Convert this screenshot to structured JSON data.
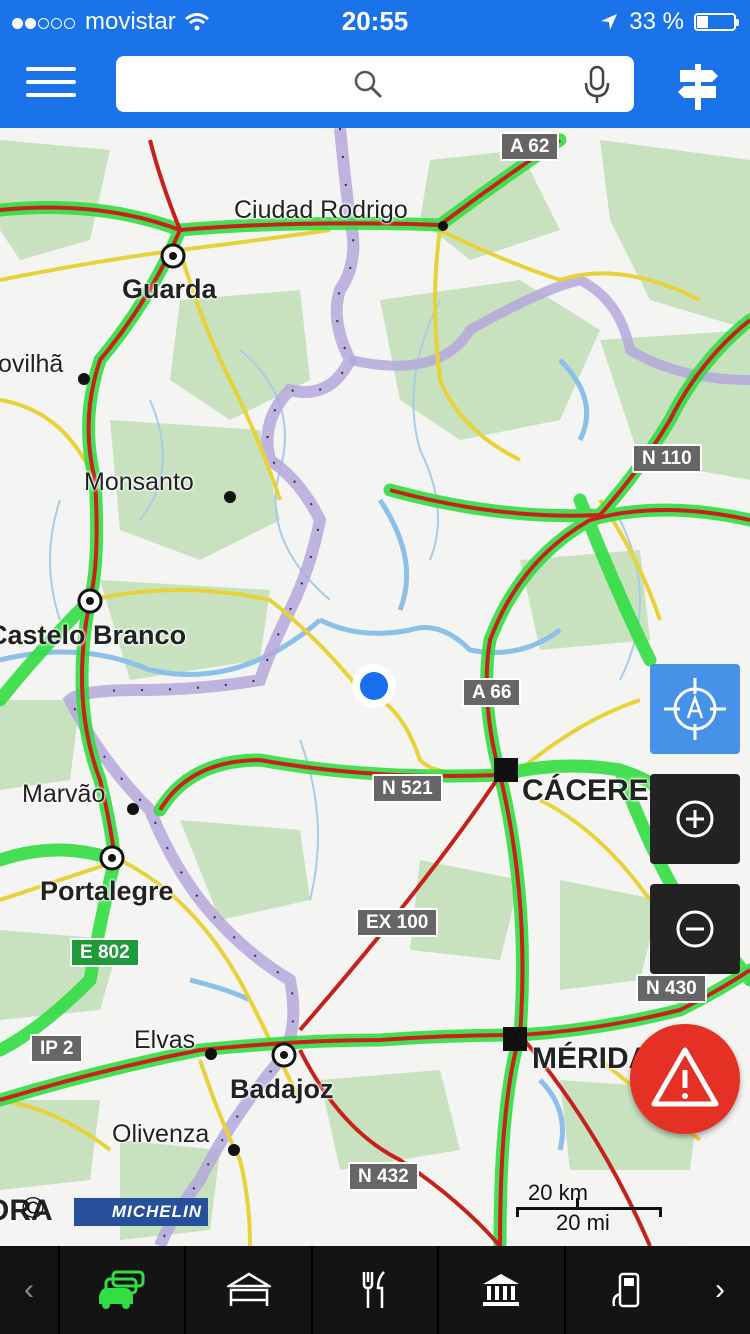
{
  "status_bar": {
    "carrier": "movistar",
    "time": "20:55",
    "battery": "33 %",
    "battery_level": 0.33,
    "signal_bars_filled": 2,
    "signal_bars_total": 5
  },
  "toolbar": {
    "search_value": "",
    "icons": [
      "menu-icon",
      "search-icon",
      "microphone-icon",
      "signpost-icon"
    ]
  },
  "map": {
    "cities": [
      "Guarda",
      "Castelo Branco",
      "Portalegre",
      "Badajoz",
      "CÁCERES",
      "MÉRIDA"
    ],
    "towns": [
      "Ciudad Rodrigo",
      "Covilhã",
      "Monsanto",
      "Marvão",
      "Elvas",
      "Olivenza"
    ],
    "road_shields": [
      "A 62",
      "N 110",
      "A 66",
      "N 521",
      "EX 100",
      "E 802",
      "N 430",
      "IP 2",
      "N 432"
    ],
    "labels": {
      "guarda": "Guarda",
      "castelo_branco": "Castelo Branco",
      "portalegre": "Portalegre",
      "badajoz": "Badajoz",
      "caceres": "CÁCERES",
      "merida": "MÉRIDA",
      "ciudad_rodrigo": "Ciudad Rodrigo",
      "covilha": "ovilhã",
      "monsanto": "Monsanto",
      "marvao": "Marvão",
      "elvas": "Elvas",
      "olivenza": "Olivenza",
      "left_edge": "ORA"
    },
    "shields": {
      "a62": "A 62",
      "n110": "N 110",
      "a66": "A 66",
      "n521": "N 521",
      "ex100": "EX 100",
      "e802": "E 802",
      "n430": "N 430",
      "ip2": "IP 2",
      "n432": "N 432",
      "a66_bottom": "66"
    },
    "colors": {
      "traffic_green": "#33dd44",
      "road_red": "#c6221d",
      "road_yellow": "#e8d23a",
      "border_purple": "#b4a8dc",
      "water": "#8cc0e8",
      "forest": "#c8e2c0",
      "accent_blue": "#1a73e8"
    }
  },
  "controls": {
    "locate_icon": "crosshair-icon",
    "zoom_in_icon": "plus-icon",
    "zoom_out_icon": "minus-icon",
    "alert_icon": "warning-icon"
  },
  "scale": {
    "km": "20 km",
    "mi": "20 mi"
  },
  "branding": {
    "copyright": "©",
    "michelin": "MICHELIN"
  },
  "bottom_bar": {
    "categories": [
      "traffic-icon",
      "hotel-icon",
      "restaurant-icon",
      "museum-icon",
      "fuel-icon"
    ],
    "left_arrow": "‹",
    "right_arrow": "›"
  }
}
